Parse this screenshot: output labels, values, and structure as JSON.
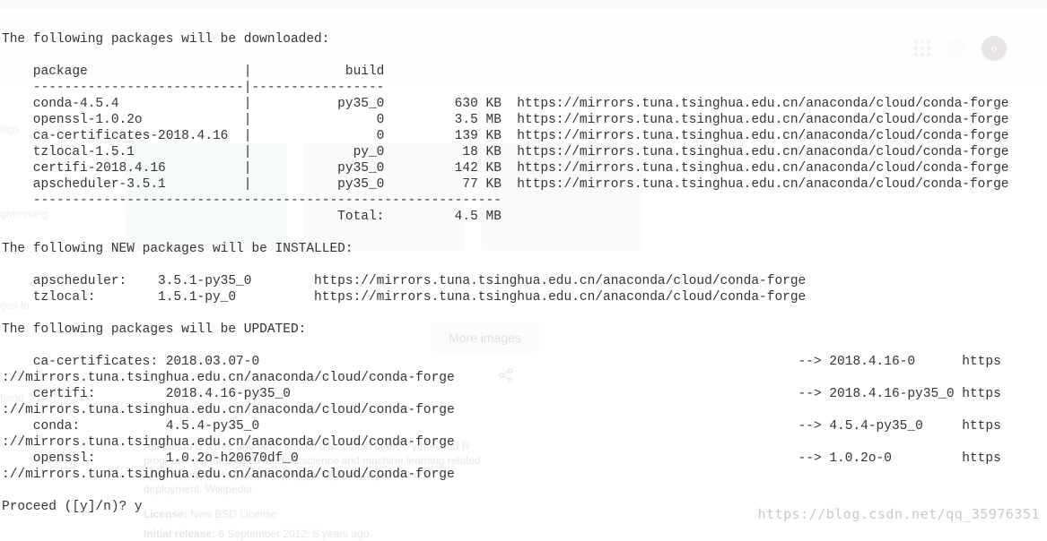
{
  "background": {
    "avatar_letter": "e",
    "more_images_label": "More images",
    "side_labels": {
      "ings": "ings",
      "gramming": "gramming",
      "ges_for": "ges fo",
      "hand": "hand"
    },
    "info_block": "Anaconda is a free and open source distribution of the Python and R\nprogramming languages for data science and machine learning related\napplications, that aims to simplify package management and\ndeployment. Wikipedia",
    "license_label": "License:",
    "license_value": "New BSD License",
    "release_label": "Initial release:",
    "release_value": "6 September 2012; 5 years ago"
  },
  "terminal": {
    "intro_line": "The following packages will be downloaded:",
    "header_package": "package",
    "header_build": "build",
    "divider_top": "    ---------------------------|-----------------",
    "rows": [
      {
        "pkg": "conda-4.5.4",
        "build": "py35_0",
        "size": "630 KB",
        "url": "https://mirrors.tuna.tsinghua.edu.cn/anaconda/cloud/conda-forge"
      },
      {
        "pkg": "openssl-1.0.2o",
        "build": "0",
        "size": "3.5 MB",
        "url": "https://mirrors.tuna.tsinghua.edu.cn/anaconda/cloud/conda-forge"
      },
      {
        "pkg": "ca-certificates-2018.4.16",
        "build": "0",
        "size": "139 KB",
        "url": "https://mirrors.tuna.tsinghua.edu.cn/anaconda/cloud/conda-forge"
      },
      {
        "pkg": "tzlocal-1.5.1",
        "build": "py_0",
        "size": "18 KB",
        "url": "https://mirrors.tuna.tsinghua.edu.cn/anaconda/cloud/conda-forge"
      },
      {
        "pkg": "certifi-2018.4.16",
        "build": "py35_0",
        "size": "142 KB",
        "url": "https://mirrors.tuna.tsinghua.edu.cn/anaconda/cloud/conda-forge"
      },
      {
        "pkg": "apscheduler-3.5.1",
        "build": "py35_0",
        "size": "77 KB",
        "url": "https://mirrors.tuna.tsinghua.edu.cn/anaconda/cloud/conda-forge"
      }
    ],
    "divider_bottom": "    ------------------------------------------------------------",
    "total_label": "Total:",
    "total_value": "4.5 MB",
    "new_pkgs_header": "The following NEW packages will be INSTALLED:",
    "new_pkgs": [
      {
        "name": "apscheduler:",
        "ver": "3.5.1-py35_0",
        "url": "https://mirrors.tuna.tsinghua.edu.cn/anaconda/cloud/conda-forge"
      },
      {
        "name": "tzlocal:",
        "ver": "1.5.1-py_0",
        "url": "https://mirrors.tuna.tsinghua.edu.cn/anaconda/cloud/conda-forge"
      }
    ],
    "updated_header": "The following packages will be UPDATED:",
    "updated": [
      {
        "name": "ca-certificates:",
        "from": "2018.03.07-0",
        "to": "2018.4.16-0",
        "url_prefix": "https",
        "wrap_url": "://mirrors.tuna.tsinghua.edu.cn/anaconda/cloud/conda-forge"
      },
      {
        "name": "certifi:",
        "from": "2018.4.16-py35_0",
        "to": "2018.4.16-py35_0",
        "url_prefix": "https",
        "wrap_url": "://mirrors.tuna.tsinghua.edu.cn/anaconda/cloud/conda-forge"
      },
      {
        "name": "conda:",
        "from": "4.5.4-py35_0",
        "to": "4.5.4-py35_0",
        "url_prefix": "https",
        "wrap_url": "://mirrors.tuna.tsinghua.edu.cn/anaconda/cloud/conda-forge"
      },
      {
        "name": "openssl:",
        "from": "1.0.2o-h20670df_0",
        "to": "1.0.2o-0",
        "url_prefix": "https",
        "wrap_url": "://mirrors.tuna.tsinghua.edu.cn/anaconda/cloud/conda-forge"
      }
    ],
    "proceed_prompt": "Proceed ([y]/n)? ",
    "proceed_answer": "y"
  },
  "watermark": "https://blog.csdn.net/qq_35976351"
}
